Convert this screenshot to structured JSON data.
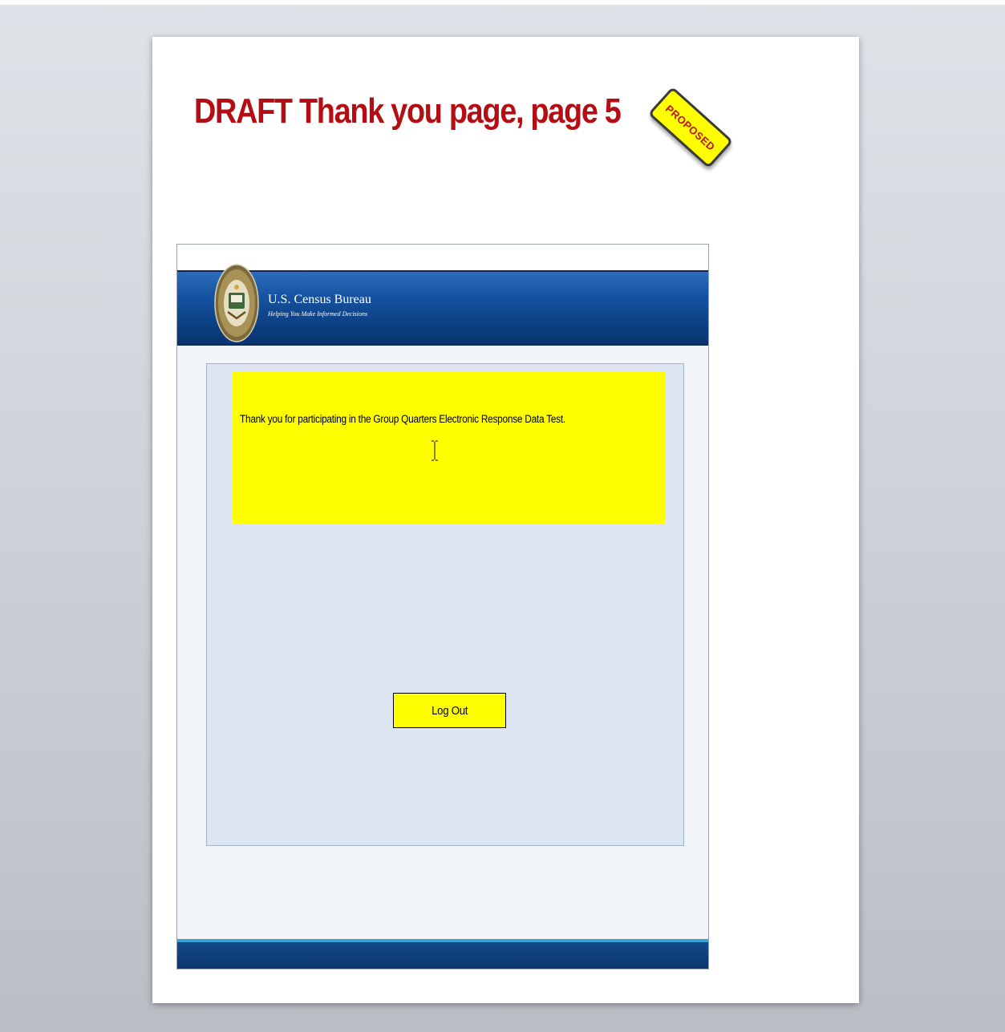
{
  "slide": {
    "title": "DRAFT Thank you page, page 5",
    "stamp": "PROPOSED"
  },
  "header": {
    "agency_name": "U.S. Census Bureau",
    "tagline": "Helping You Make Informed Decisions",
    "seal_icon": "department-of-commerce-seal"
  },
  "main": {
    "message": "Thank you for participating in the Group Quarters Electronic Response Data Test.",
    "logout_label": "Log Out"
  },
  "colors": {
    "title_red": "#b40e14",
    "highlight_yellow": "#ffff00",
    "banner_blue": "#1552a0",
    "panel_blue": "#dce5f1"
  }
}
